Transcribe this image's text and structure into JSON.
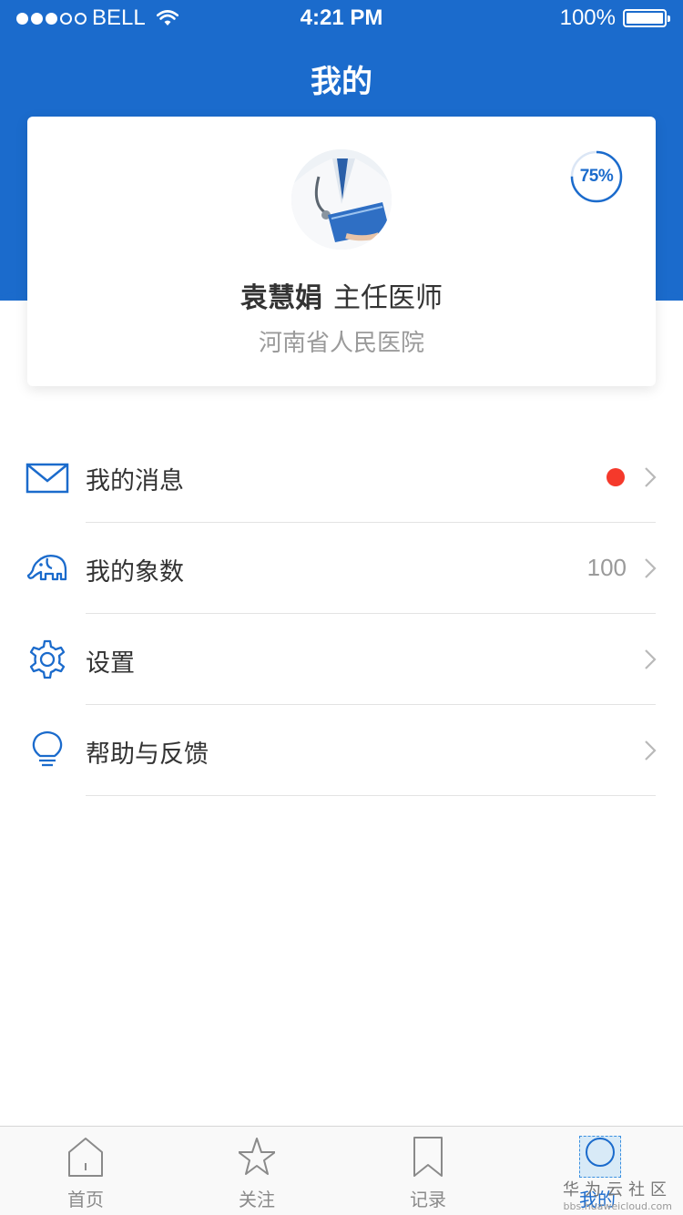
{
  "colors": {
    "primary": "#1b6bcc",
    "badge": "#f5392b",
    "background": "#ffffff"
  },
  "status_bar": {
    "carrier": "BELL",
    "time": "4:21 PM",
    "battery": "100%"
  },
  "page_title": "我的",
  "profile": {
    "avatar_icon": "doctor-avatar",
    "completion": "75%",
    "completion_fraction": 0.75,
    "name": "袁慧娟",
    "title": "主任医师",
    "hospital": "河南省人民医院"
  },
  "menu": [
    {
      "label": "我的消息",
      "icon": "mail-icon",
      "has_badge": true
    },
    {
      "label": "我的象数",
      "icon": "elephant-icon",
      "value": "100"
    },
    {
      "label": "设置",
      "icon": "gear-icon"
    },
    {
      "label": "帮助与反馈",
      "icon": "lightbulb-icon"
    }
  ],
  "tabs": [
    {
      "label": "首页",
      "icon": "home-icon"
    },
    {
      "label": "关注",
      "icon": "star-icon"
    },
    {
      "label": "记录",
      "icon": "bookmark-icon"
    },
    {
      "label": "我的",
      "icon": "profile-icon",
      "active": true
    }
  ],
  "watermark": {
    "text": "华为云社区",
    "url": "bbs.huaweicloud.com"
  }
}
